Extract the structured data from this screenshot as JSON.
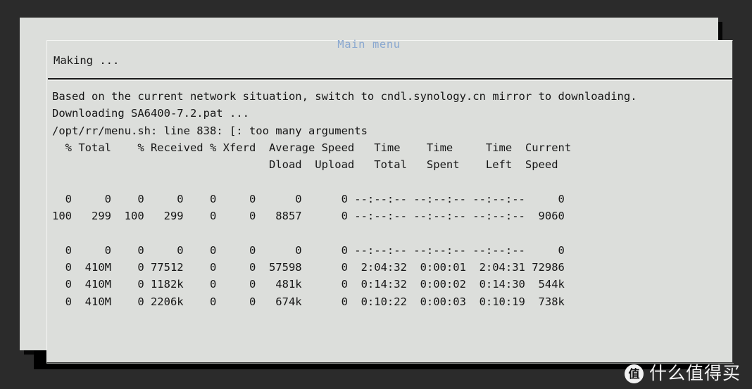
{
  "window": {
    "title": "Main menu",
    "title_color": "#8aa8d0",
    "background_color": "#dcdedb",
    "text_color": "#161616",
    "desktop_color": "#2b2b2b",
    "panel_color": "#000000"
  },
  "status": {
    "label": "Making ..."
  },
  "console": {
    "lines": [
      "Based on the current network situation, switch to cndl.synology.cn mirror to downloading.",
      "Downloading SA6400-7.2.pat ...",
      "/opt/rr/menu.sh: line 838: [: too many arguments",
      "  % Total    % Received % Xferd  Average Speed   Time    Time     Time  Current",
      "                                 Dload  Upload   Total   Spent    Left  Speed",
      "",
      "  0     0    0     0    0     0      0      0 --:--:-- --:--:-- --:--:--     0",
      "100   299  100   299    0     0   8857      0 --:--:-- --:--:-- --:--:--  9060",
      "",
      "  0     0    0     0    0     0      0      0 --:--:-- --:--:-- --:--:--     0",
      "  0  410M    0 77512    0     0  57598      0  2:04:32  0:00:01  2:04:31 72986",
      "  0  410M    0 1182k    0     0   481k      0  0:14:32  0:00:02  0:14:30  544k",
      "  0  410M    0 2206k    0     0   674k      0  0:10:22  0:00:03  0:10:19  738k"
    ],
    "progress_header": {
      "columns": [
        "% Total",
        "% Received",
        "% Xferd",
        "Average Speed Dload",
        "Average Speed Upload",
        "Time Total",
        "Time Spent",
        "Time Left",
        "Current Speed"
      ]
    },
    "progress_rows": [
      {
        "pct_total": "0",
        "total": "0",
        "pct_received": "0",
        "received": "0",
        "pct_xferd": "0",
        "xferd": "0",
        "dload": "0",
        "upload": "0",
        "time_total": "--:--:--",
        "time_spent": "--:--:--",
        "time_left": "--:--:--",
        "current_speed": "0"
      },
      {
        "pct_total": "100",
        "total": "299",
        "pct_received": "100",
        "received": "299",
        "pct_xferd": "0",
        "xferd": "0",
        "dload": "8857",
        "upload": "0",
        "time_total": "--:--:--",
        "time_spent": "--:--:--",
        "time_left": "--:--:--",
        "current_speed": "9060"
      },
      {
        "pct_total": "0",
        "total": "0",
        "pct_received": "0",
        "received": "0",
        "pct_xferd": "0",
        "xferd": "0",
        "dload": "0",
        "upload": "0",
        "time_total": "--:--:--",
        "time_spent": "--:--:--",
        "time_left": "--:--:--",
        "current_speed": "0"
      },
      {
        "pct_total": "0",
        "total": "410M",
        "pct_received": "0",
        "received": "77512",
        "pct_xferd": "0",
        "xferd": "0",
        "dload": "57598",
        "upload": "0",
        "time_total": "2:04:32",
        "time_spent": "0:00:01",
        "time_left": "2:04:31",
        "current_speed": "72986"
      },
      {
        "pct_total": "0",
        "total": "410M",
        "pct_received": "0",
        "received": "1182k",
        "pct_xferd": "0",
        "xferd": "0",
        "dload": "481k",
        "upload": "0",
        "time_total": "0:14:32",
        "time_spent": "0:00:02",
        "time_left": "0:14:30",
        "current_speed": "544k"
      },
      {
        "pct_total": "0",
        "total": "410M",
        "pct_received": "0",
        "received": "2206k",
        "pct_xferd": "0",
        "xferd": "0",
        "dload": "674k",
        "upload": "0",
        "time_total": "0:10:22",
        "time_spent": "0:00:03",
        "time_left": "0:10:19",
        "current_speed": "738k"
      }
    ],
    "download_file": "SA6400-7.2.pat",
    "mirror_host": "cndl.synology.cn",
    "error_script": "/opt/rr/menu.sh",
    "error_line": "838",
    "error_message": "[: too many arguments"
  },
  "watermark": {
    "badge": "值",
    "text": "什么值得买"
  }
}
